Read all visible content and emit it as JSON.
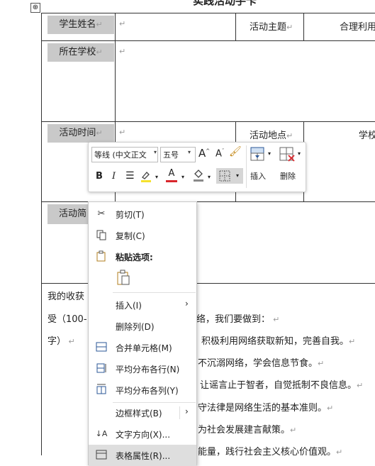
{
  "doc": {
    "title_partial": "实践活动手卡",
    "move_handle": "⊕",
    "para_mark": "↵",
    "table": {
      "student_name_label": "学生姓名",
      "activity_theme_label": "活动主题",
      "theme_value": "合理利用",
      "school_label": "所在学校",
      "time_label": "活动时间",
      "place_label": "活动地点",
      "place_value": "学校",
      "intro_label": "活动简",
      "gain_lines": [
        "我的收获",
        "受（100-",
        "字）"
      ],
      "right_lines": [
        "络，我们要做到：",
        "积极利用网络获取新知，完善自我。",
        "不沉溺网络，学会信息节食。",
        "让谣言止于智者，自觉抵制不良信息。",
        "守法律是网络生活的基本准则。",
        "为社会发展建言献策。",
        "能量，践行社会主义核心价值观。"
      ]
    }
  },
  "toolbar": {
    "font_name": "等线 (中文正文",
    "font_size": "五号",
    "grow_font": "A",
    "shrink_font": "A",
    "bold": "B",
    "italic": "I",
    "insert_label": "插入",
    "delete_label": "删除"
  },
  "menu": {
    "cut": "剪切(T)",
    "copy": "复制(C)",
    "paste_options": "粘贴选项:",
    "insert": "插入(I)",
    "delete_col": "删除列(D)",
    "merge": "合并单元格(M)",
    "dist_rows": "平均分布各行(N)",
    "dist_cols": "平均分布各列(Y)",
    "border_style": "边框样式(B)",
    "text_dir": "文字方向(X)...",
    "table_props": "表格属性(R)..."
  },
  "colors": {
    "highlight": "#f5e12e",
    "font_color": "#d9262c",
    "menu_bg": "#ffffff",
    "label_bg": "#c9c9c9"
  }
}
